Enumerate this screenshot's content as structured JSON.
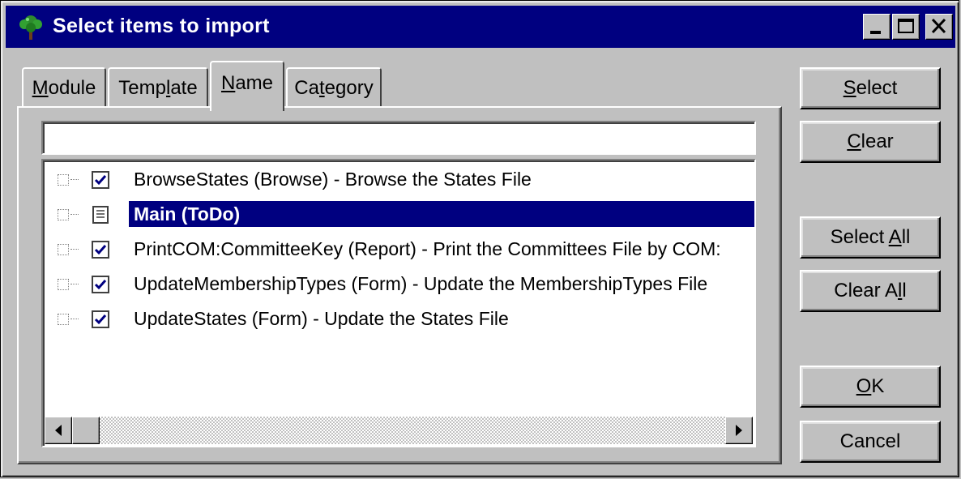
{
  "window": {
    "title": "Select items to import",
    "controls": [
      "minimize-icon",
      "maximize-icon",
      "close-icon"
    ],
    "colors": {
      "titlebar": "#000080",
      "face": "#c0c0c0",
      "selection": "#000080"
    }
  },
  "tabs": [
    {
      "pre": "",
      "u": "M",
      "post": "odule",
      "active": false
    },
    {
      "pre": "Temp",
      "u": "l",
      "post": "ate",
      "active": false
    },
    {
      "pre": "",
      "u": "N",
      "post": "ame",
      "active": true
    },
    {
      "pre": "Ca",
      "u": "t",
      "post": "egory",
      "active": false
    }
  ],
  "search": {
    "value": ""
  },
  "items": [
    {
      "label": "BrowseStates (Browse) - Browse the States File",
      "checked": true,
      "icon": "checkbox-checked-icon",
      "selected": false
    },
    {
      "label": "Main (ToDo)",
      "checked": false,
      "icon": "document-icon",
      "selected": true
    },
    {
      "label": "PrintCOM:CommitteeKey (Report) - Print the Committees File by COM:",
      "checked": true,
      "icon": "checkbox-checked-icon",
      "selected": false
    },
    {
      "label": "UpdateMembershipTypes (Form) - Update the MembershipTypes File",
      "checked": true,
      "icon": "checkbox-checked-icon",
      "selected": false
    },
    {
      "label": "UpdateStates (Form) - Update the States File",
      "checked": true,
      "icon": "checkbox-checked-icon",
      "selected": false
    }
  ],
  "buttons": {
    "select": {
      "pre": "",
      "u": "S",
      "post": "elect"
    },
    "clear": {
      "pre": "",
      "u": "C",
      "post": "lear"
    },
    "select_all": {
      "pre": "Select ",
      "u": "A",
      "post": "ll"
    },
    "clear_all": {
      "pre": "Clear A",
      "u": "l",
      "post": "l"
    },
    "ok": {
      "pre": "",
      "u": "O",
      "post": "K"
    },
    "cancel": {
      "pre": "Cancel",
      "u": "",
      "post": ""
    }
  }
}
